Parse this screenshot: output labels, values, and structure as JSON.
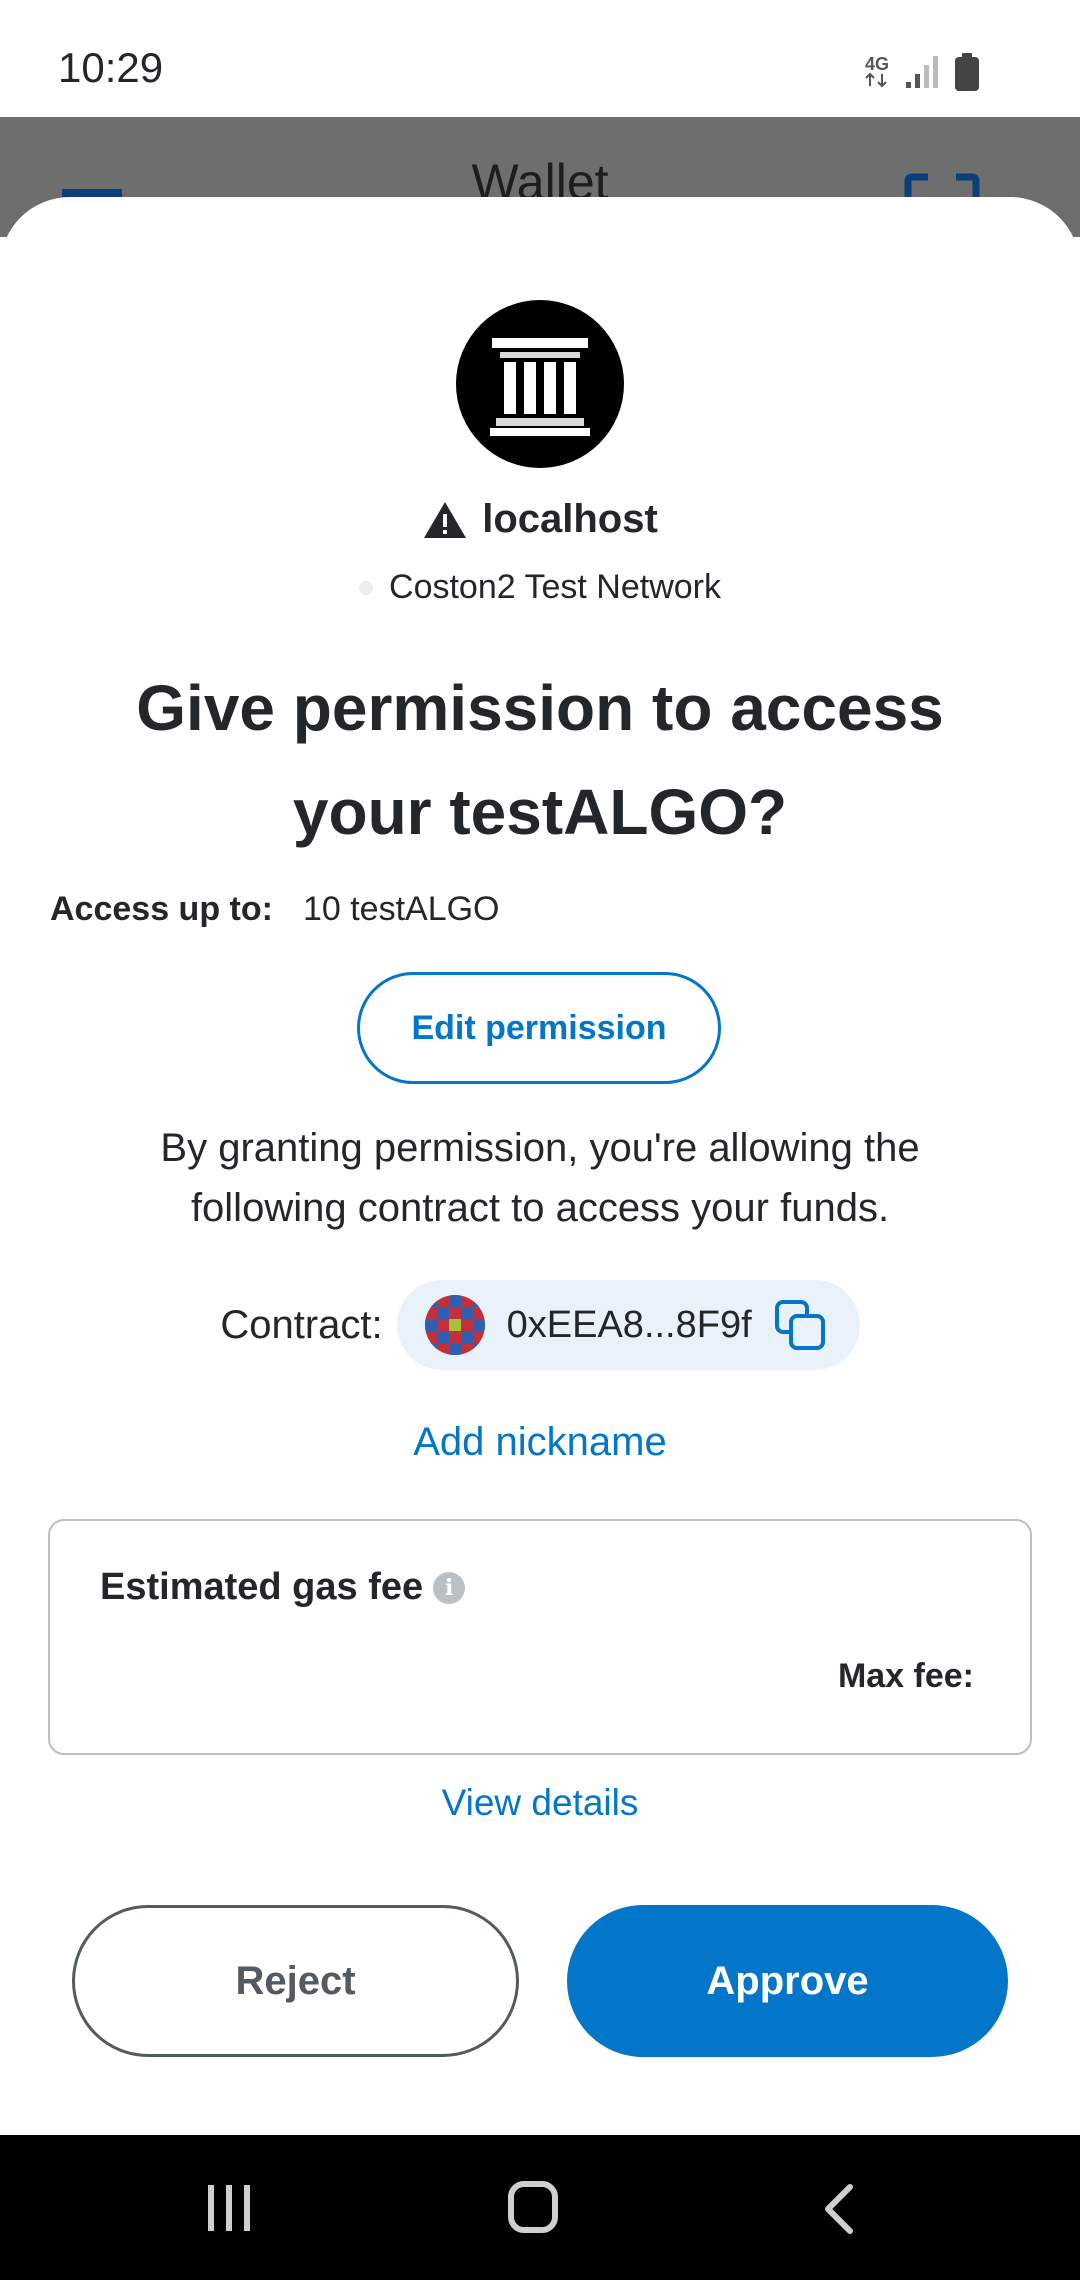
{
  "status_bar": {
    "time": "10:29",
    "network_type": "4G"
  },
  "app_header": {
    "title": "Wallet"
  },
  "site": {
    "name": "localhost",
    "network": "Coston2 Test Network"
  },
  "dialog": {
    "title": "Give permission to access your testALGO?",
    "access_label": "Access up to:",
    "access_value": "10 testALGO",
    "edit_permission": "Edit permission",
    "description": "By granting permission, you're allowing the following contract to access your funds.",
    "contract_label": "Contract:",
    "contract_address": "0xEEA8...8F9f",
    "add_nickname": "Add nickname",
    "gas_label": "Estimated gas fee",
    "max_fee_label": "Max fee:",
    "view_details": "View details",
    "reject": "Reject",
    "approve": "Approve"
  },
  "colors": {
    "accent": "#0376c9",
    "text": "#24272a",
    "border": "#bbc0c5"
  }
}
